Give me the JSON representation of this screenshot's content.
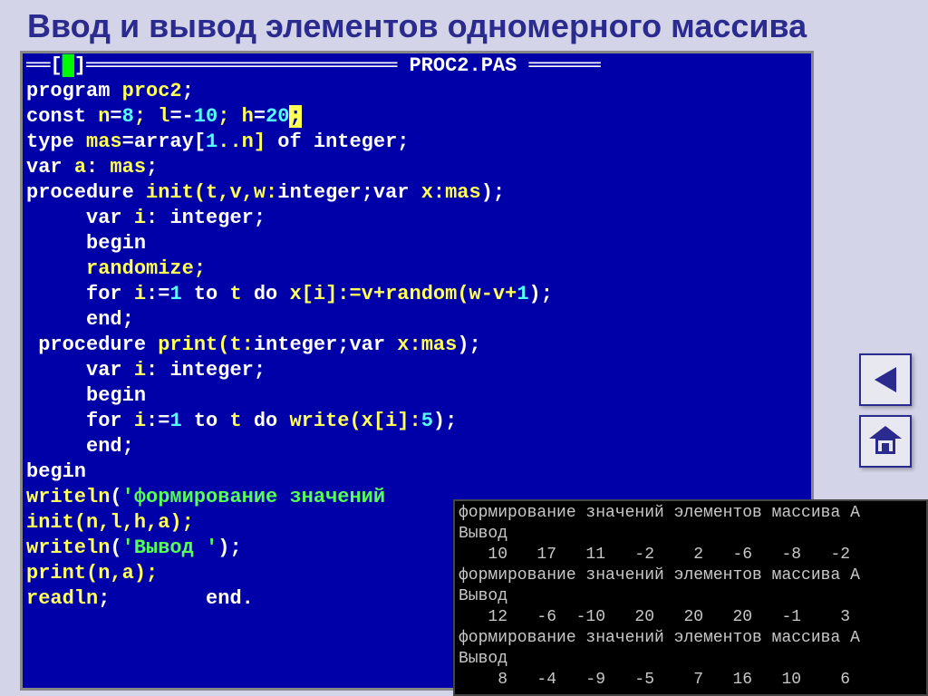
{
  "page_title": "Ввод и вывод элементов одномерного массива",
  "filename": "PROC2.PAS",
  "code": {
    "l1a": "program ",
    "l1b": "proc2",
    "l1c": ";",
    "l2a": "const ",
    "l2b": "n",
    "l2c": "=",
    "l2d": "8",
    "l2e": "; l",
    "l2f": "=-",
    "l2g": "10",
    "l2h": "; h",
    "l2i": "=",
    "l2j": "20",
    "l3a": "type ",
    "l3b": "mas",
    "l3c": "=",
    "l3d": "array",
    "l3e": "[",
    "l3f": "1",
    "l3g": "..n] ",
    "l3h": "of integer",
    "l3i": ";",
    "l4a": "var ",
    "l4b": "a",
    "l4c": ": ",
    "l4d": "mas",
    "l4e": ";",
    "l5a": "procedure ",
    "l5b": "init",
    "l5c": "(t,v,w:",
    "l5d": "integer",
    "l5e": ";",
    "l5f": "var ",
    "l5g": "x:",
    "l5h": "mas",
    "l5i": ");",
    "l6a": "     var ",
    "l6b": "i",
    "l6c": ": ",
    "l6d": "integer",
    "l6e": ";",
    "l7a": "     begin",
    "l8a": "     randomize;",
    "l9a": "     for ",
    "l9b": "i",
    "l9c": ":=",
    "l9d": "1",
    "l9e": " to ",
    "l9f": "t ",
    "l9g": "do ",
    "l9h": "x",
    "l9i": "[i]:=v+",
    "l9j": "random",
    "l9k": "(w-v+",
    "l9l": "1",
    "l9m": ");",
    "l10a": "     end",
    "l10b": ";",
    "l11a": " procedure ",
    "l11b": "print",
    "l11c": "(t:",
    "l11d": "integer",
    "l11e": ";",
    "l11f": "var ",
    "l11g": "x:",
    "l11h": "mas",
    "l11i": ");",
    "l12a": "     var ",
    "l12b": "i",
    "l12c": ": ",
    "l12d": "integer",
    "l12e": ";",
    "l13a": "     begin",
    "l14a": "     for ",
    "l14b": "i",
    "l14c": ":=",
    "l14d": "1",
    "l14e": " to ",
    "l14f": "t ",
    "l14g": "do ",
    "l14h": "write",
    "l14i": "(x[i]:",
    "l14j": "5",
    "l14k": ");",
    "l15a": "     end",
    "l15b": ";",
    "l16a": "begin",
    "l17a": "writeln",
    "l17b": "(",
    "l17c": "'формирование значений",
    "l18a": "init",
    "l18b": "(n,l,h,a);",
    "l19a": "writeln",
    "l19b": "(",
    "l19c": "'Вывод '",
    "l19d": ");",
    "l20a": "print",
    "l20b": "(n,a);",
    "l21a": "readln",
    "l21b": ";        ",
    "l21c": "end",
    "l21d": "."
  },
  "output": {
    "o1": "формирование значений элементов массива A",
    "o2": "Вывод",
    "o3": "   10   17   11   -2    2   -6   -8   -2",
    "o4": "формирование значений элементов массива A",
    "o5": "Вывод",
    "o6": "   12   -6  -10   20   20   20   -1    3",
    "o7": "формирование значений элементов массива A",
    "o8": "Вывод",
    "o9": "    8   -4   -9   -5    7   16   10    6"
  },
  "nav": {
    "back": "back",
    "home": "home"
  }
}
